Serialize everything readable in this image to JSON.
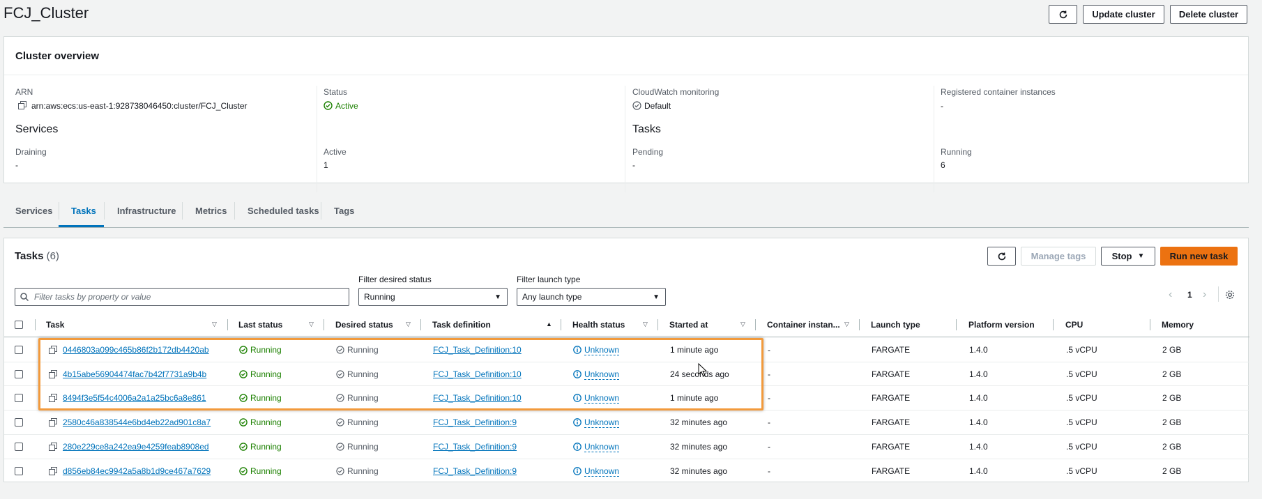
{
  "page": {
    "title": "FCJ_Cluster"
  },
  "header_buttons": {
    "update": "Update cluster",
    "delete": "Delete cluster"
  },
  "overview": {
    "heading": "Cluster overview",
    "arn_label": "ARN",
    "arn_value": "arn:aws:ecs:us-east-1:928738046450:cluster/FCJ_Cluster",
    "status_label": "Status",
    "status_value": "Active",
    "cloudwatch_label": "CloudWatch monitoring",
    "cloudwatch_value": "Default",
    "registered_label": "Registered container instances",
    "registered_value": "-",
    "services_heading": "Services",
    "draining_label": "Draining",
    "draining_value": "-",
    "active_label": "Active",
    "active_value": "1",
    "tasks_heading": "Tasks",
    "pending_label": "Pending",
    "pending_value": "-",
    "running_label": "Running",
    "running_value": "6"
  },
  "tabs": [
    "Services",
    "Tasks",
    "Infrastructure",
    "Metrics",
    "Scheduled tasks",
    "Tags"
  ],
  "tasks_panel": {
    "title": "Tasks",
    "count": "(6)",
    "manage_tags": "Manage tags",
    "stop": "Stop",
    "run_new": "Run new task",
    "search_placeholder": "Filter tasks by property or value",
    "filter_status_label": "Filter desired status",
    "filter_status_value": "Running",
    "filter_launch_label": "Filter launch type",
    "filter_launch_value": "Any launch type",
    "page_number": "1"
  },
  "columns": [
    "Task",
    "Last status",
    "Desired status",
    "Task definition",
    "Health status",
    "Started at",
    "Container instan...",
    "Launch type",
    "Platform version",
    "CPU",
    "Memory"
  ],
  "rows": [
    {
      "task": "0446803a099c465b86f2b172db4420ab",
      "last": "Running",
      "desired": "Running",
      "def": "FCJ_Task_Definition:10",
      "health": "Unknown",
      "started": "1 minute ago",
      "container": "-",
      "launch": "FARGATE",
      "platform": "1.4.0",
      "cpu": ".5 vCPU",
      "memory": "2 GB"
    },
    {
      "task": "4b15abe56904474fac7b42f7731a9b4b",
      "last": "Running",
      "desired": "Running",
      "def": "FCJ_Task_Definition:10",
      "health": "Unknown",
      "started": "24 seconds ago",
      "container": "-",
      "launch": "FARGATE",
      "platform": "1.4.0",
      "cpu": ".5 vCPU",
      "memory": "2 GB"
    },
    {
      "task": "8494f3e5f54c4006a2a1a25bc6a8e861",
      "last": "Running",
      "desired": "Running",
      "def": "FCJ_Task_Definition:10",
      "health": "Unknown",
      "started": "1 minute ago",
      "container": "-",
      "launch": "FARGATE",
      "platform": "1.4.0",
      "cpu": ".5 vCPU",
      "memory": "2 GB"
    },
    {
      "task": "2580c46a838544e6bd4eb22ad901c8a7",
      "last": "Running",
      "desired": "Running",
      "def": "FCJ_Task_Definition:9",
      "health": "Unknown",
      "started": "32 minutes ago",
      "container": "-",
      "launch": "FARGATE",
      "platform": "1.4.0",
      "cpu": ".5 vCPU",
      "memory": "2 GB"
    },
    {
      "task": "280e229ce8a242ea9e4259feab8908ed",
      "last": "Running",
      "desired": "Running",
      "def": "FCJ_Task_Definition:9",
      "health": "Unknown",
      "started": "32 minutes ago",
      "container": "-",
      "launch": "FARGATE",
      "platform": "1.4.0",
      "cpu": ".5 vCPU",
      "memory": "2 GB"
    },
    {
      "task": "d856eb84ec9942a5a8b1d9ce467a7629",
      "last": "Running",
      "desired": "Running",
      "def": "FCJ_Task_Definition:9",
      "health": "Unknown",
      "started": "32 minutes ago",
      "container": "-",
      "launch": "FARGATE",
      "platform": "1.4.0",
      "cpu": ".5 vCPU",
      "memory": "2 GB"
    }
  ],
  "colors": {
    "accent": "#0073bb",
    "success": "#1d8102",
    "primary_button": "#ec7211",
    "highlight": "#f29a3c"
  }
}
